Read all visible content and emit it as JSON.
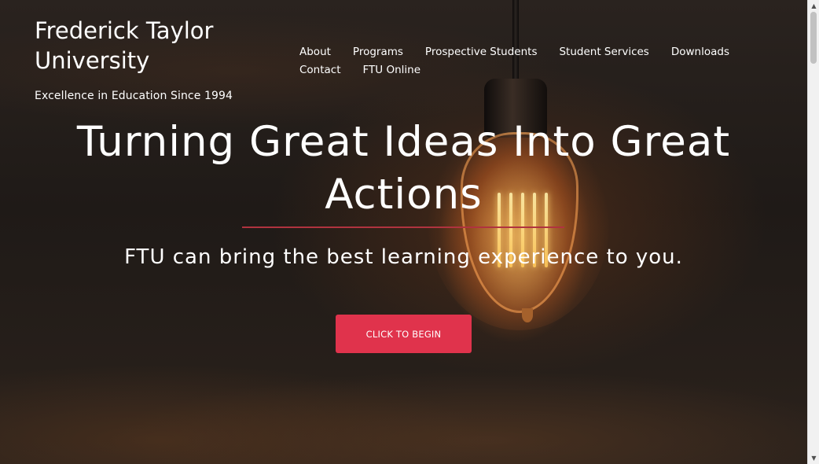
{
  "site": {
    "title": "Frederick Taylor University",
    "tagline": "Excellence in Education Since 1994"
  },
  "nav": {
    "items": [
      {
        "label": "About"
      },
      {
        "label": "Programs"
      },
      {
        "label": "Prospective Students"
      },
      {
        "label": "Student Services"
      },
      {
        "label": "Downloads"
      },
      {
        "label": "Contact"
      },
      {
        "label": "FTU Online"
      }
    ]
  },
  "hero": {
    "title": "Turning Great Ideas Into Great Actions",
    "subtitle": "FTU can bring the best learning experience to you.",
    "cta_label": "CLICK TO BEGIN"
  },
  "scrollbar": {
    "up_icon": "scroll-up-arrow",
    "down_icon": "scroll-down-arrow",
    "up_glyph": "▲",
    "down_glyph": "▼"
  },
  "colors": {
    "accent": "#e0334c",
    "divider": "#b0333f",
    "text": "#ffffff"
  }
}
